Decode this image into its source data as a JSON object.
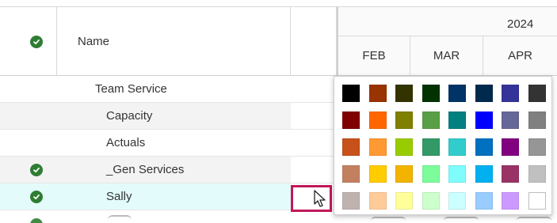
{
  "header": {
    "name_label": "Name",
    "year": "2024",
    "months": [
      "FEB",
      "MAR",
      "APR"
    ]
  },
  "rows": [
    {
      "label": "Team Service",
      "indent": 1,
      "check": false,
      "bg": "#ffffff"
    },
    {
      "label": "Capacity",
      "indent": 2,
      "check": false,
      "bg": "#f3f3f3"
    },
    {
      "label": "Actuals",
      "indent": 2,
      "check": false,
      "bg": "#ffffff"
    },
    {
      "label": "_Gen Services",
      "indent": 2,
      "check": true,
      "bg": "#f3f3f3"
    },
    {
      "label": "Sally",
      "indent": 2,
      "check": true,
      "bg": "#e3fbfb",
      "selected": true
    }
  ],
  "colors": {
    "accent_check": "#2e7d32",
    "selection_border": "#c2185b",
    "selected_row": "#e3fbfb"
  },
  "palette": {
    "rows": [
      [
        "#000000",
        "#993300",
        "#333300",
        "#003300",
        "#003366",
        "#002a4d",
        "#333399",
        "#333333"
      ],
      [
        "#800000",
        "#ff6600",
        "#808000",
        "#5a9f45",
        "#008080",
        "#0000ff",
        "#666699",
        "#808080"
      ],
      [
        "#c8501a",
        "#ff9933",
        "#99cc00",
        "#339966",
        "#33cccc",
        "#0070c0",
        "#800080",
        "#969696"
      ],
      [
        "#c28060",
        "#ffcc00",
        "#f2b400",
        "#7cfc9b",
        "#7ffcfc",
        "#00b0f0",
        "#993366",
        "#c0c0c0"
      ],
      [
        "#bfb3b0",
        "#ffcc99",
        "#ffff99",
        "#ccffcc",
        "#ccffff",
        "#99ccff",
        "#cc99ff",
        "#ffffff"
      ]
    ]
  }
}
